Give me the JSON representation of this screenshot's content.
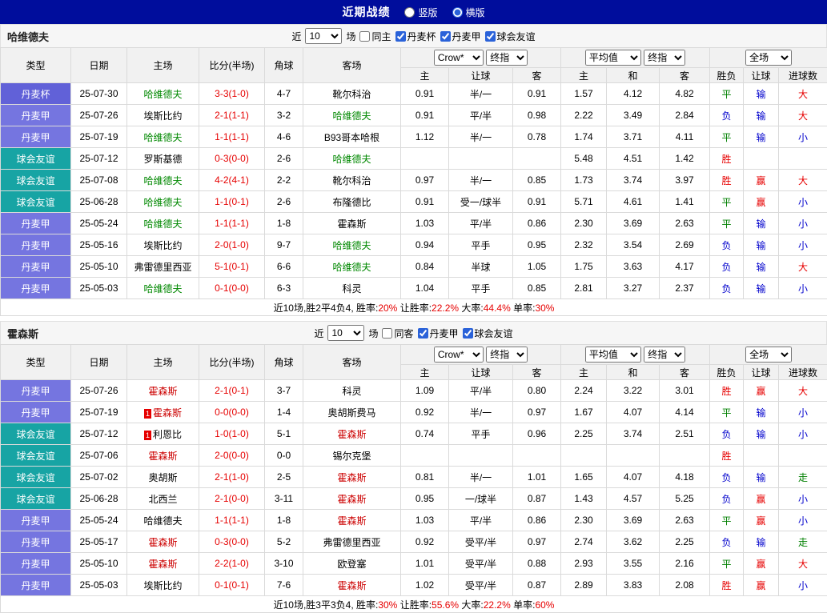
{
  "topbar": {
    "title": "近期战绩",
    "vertical_label": "竖版",
    "horizontal_label": "横版",
    "selected": "横版"
  },
  "colors": {
    "topbar_bg": "#000d9c",
    "league": {
      "丹麦杯": "#6161d8",
      "丹麦甲": "#7575e0",
      "球会友谊": "#17a4a4"
    },
    "result": {
      "胜": "#e60000",
      "平": "#008000",
      "负": "#0000cc",
      "赢": "#e60000",
      "输": "#0000cc",
      "走": "#008000",
      "大": "#e60000",
      "小": "#0000cc"
    },
    "score": "#e60000"
  },
  "selects": {
    "source": "Crow*",
    "time": "终指",
    "avg": "平均值",
    "scope": "全场"
  },
  "columns": [
    "类型",
    "日期",
    "主场",
    "比分(半场)",
    "角球",
    "客场",
    "主",
    "让球",
    "客",
    "主",
    "和",
    "客",
    "胜负",
    "让球",
    "进球数"
  ],
  "sections": [
    {
      "team": "哈维德夫",
      "team_color": "#008800",
      "filters": {
        "pre": "近",
        "count": "10",
        "post": "场",
        "same": "同主",
        "same_checked": false,
        "leagues": [
          {
            "label": "丹麦杯",
            "checked": true
          },
          {
            "label": "丹麦甲",
            "checked": true
          },
          {
            "label": "球会友谊",
            "checked": true
          }
        ]
      },
      "rows": [
        {
          "league": "丹麦杯",
          "date": "25-07-30",
          "home": "哈维德夫",
          "score": "3-3(1-0)",
          "corner": "4-7",
          "away": "靴尔科治",
          "o_home": "0.91",
          "handicap": "半/一",
          "o_away": "0.91",
          "a_home": "1.57",
          "a_draw": "4.12",
          "a_away": "4.82",
          "res": "平",
          "h_res": "输",
          "g_res": "大"
        },
        {
          "league": "丹麦甲",
          "date": "25-07-26",
          "home": "埃斯比约",
          "score": "2-1(1-1)",
          "corner": "3-2",
          "away": "哈维德夫",
          "o_home": "0.91",
          "handicap": "平/半",
          "o_away": "0.98",
          "a_home": "2.22",
          "a_draw": "3.49",
          "a_away": "2.84",
          "res": "负",
          "h_res": "输",
          "g_res": "大"
        },
        {
          "league": "丹麦甲",
          "date": "25-07-19",
          "home": "哈维德夫",
          "score": "1-1(1-1)",
          "corner": "4-6",
          "away": "B93哥本哈根",
          "o_home": "1.12",
          "handicap": "半/一",
          "o_away": "0.78",
          "a_home": "1.74",
          "a_draw": "3.71",
          "a_away": "4.11",
          "res": "平",
          "h_res": "输",
          "g_res": "小"
        },
        {
          "league": "球会友谊",
          "date": "25-07-12",
          "home": "罗斯基德",
          "score": "0-3(0-0)",
          "corner": "2-6",
          "away": "哈维德夫",
          "o_home": "",
          "handicap": "",
          "o_away": "",
          "a_home": "5.48",
          "a_draw": "4.51",
          "a_away": "1.42",
          "res": "胜",
          "h_res": "",
          "g_res": ""
        },
        {
          "league": "球会友谊",
          "date": "25-07-08",
          "home": "哈维德夫",
          "score": "4-2(4-1)",
          "corner": "2-2",
          "away": "靴尔科治",
          "o_home": "0.97",
          "handicap": "半/一",
          "o_away": "0.85",
          "a_home": "1.73",
          "a_draw": "3.74",
          "a_away": "3.97",
          "res": "胜",
          "h_res": "赢",
          "g_res": "大"
        },
        {
          "league": "球会友谊",
          "date": "25-06-28",
          "home": "哈维德夫",
          "score": "1-1(0-1)",
          "corner": "2-6",
          "away": "布隆德比",
          "o_home": "0.91",
          "handicap": "受一/球半",
          "o_away": "0.91",
          "a_home": "5.71",
          "a_draw": "4.61",
          "a_away": "1.41",
          "res": "平",
          "h_res": "赢",
          "g_res": "小"
        },
        {
          "league": "丹麦甲",
          "date": "25-05-24",
          "home": "哈维德夫",
          "score": "1-1(1-1)",
          "corner": "1-8",
          "away": "霍森斯",
          "o_home": "1.03",
          "handicap": "平/半",
          "o_away": "0.86",
          "a_home": "2.30",
          "a_draw": "3.69",
          "a_away": "2.63",
          "res": "平",
          "h_res": "输",
          "g_res": "小"
        },
        {
          "league": "丹麦甲",
          "date": "25-05-16",
          "home": "埃斯比约",
          "score": "2-0(1-0)",
          "corner": "9-7",
          "away": "哈维德夫",
          "o_home": "0.94",
          "handicap": "平手",
          "o_away": "0.95",
          "a_home": "2.32",
          "a_draw": "3.54",
          "a_away": "2.69",
          "res": "负",
          "h_res": "输",
          "g_res": "小"
        },
        {
          "league": "丹麦甲",
          "date": "25-05-10",
          "home": "弗雷德里西亚",
          "score": "5-1(0-1)",
          "corner": "6-6",
          "away": "哈维德夫",
          "o_home": "0.84",
          "handicap": "半球",
          "o_away": "1.05",
          "a_home": "1.75",
          "a_draw": "3.63",
          "a_away": "4.17",
          "res": "负",
          "h_res": "输",
          "g_res": "大"
        },
        {
          "league": "丹麦甲",
          "date": "25-05-03",
          "home": "哈维德夫",
          "score": "0-1(0-0)",
          "corner": "6-3",
          "away": "科灵",
          "o_home": "1.04",
          "handicap": "平手",
          "o_away": "0.85",
          "a_home": "2.81",
          "a_draw": "3.27",
          "a_away": "2.37",
          "res": "负",
          "h_res": "输",
          "g_res": "小"
        }
      ],
      "summary": [
        {
          "t": "近10场,胜2平4负4, 胜率:",
          "red": false
        },
        {
          "t": "20%",
          "red": true
        },
        {
          "t": " 让胜率:",
          "red": false
        },
        {
          "t": "22.2%",
          "red": true
        },
        {
          "t": " 大率:",
          "red": false
        },
        {
          "t": "44.4%",
          "red": true
        },
        {
          "t": " 单率:",
          "red": false
        },
        {
          "t": "30%",
          "red": true
        }
      ]
    },
    {
      "team": "霍森斯",
      "team_color": "#cc0000",
      "filters": {
        "pre": "近",
        "count": "10",
        "post": "场",
        "same": "同客",
        "same_checked": false,
        "leagues": [
          {
            "label": "丹麦甲",
            "checked": true
          },
          {
            "label": "球会友谊",
            "checked": true
          }
        ]
      },
      "rows": [
        {
          "league": "丹麦甲",
          "date": "25-07-26",
          "home": "霍森斯",
          "score": "2-1(0-1)",
          "corner": "3-7",
          "away": "科灵",
          "o_home": "1.09",
          "handicap": "平/半",
          "o_away": "0.80",
          "a_home": "2.24",
          "a_draw": "3.22",
          "a_away": "3.01",
          "res": "胜",
          "h_res": "赢",
          "g_res": "大"
        },
        {
          "league": "丹麦甲",
          "date": "25-07-19",
          "home": "霍森斯",
          "home_cards": "1",
          "score": "0-0(0-0)",
          "corner": "1-4",
          "away": "奥胡斯费马",
          "o_home": "0.92",
          "handicap": "半/一",
          "o_away": "0.97",
          "a_home": "1.67",
          "a_draw": "4.07",
          "a_away": "4.14",
          "res": "平",
          "h_res": "输",
          "g_res": "小"
        },
        {
          "league": "球会友谊",
          "date": "25-07-12",
          "home": "利恩比",
          "home_cards": "1",
          "score": "1-0(1-0)",
          "corner": "5-1",
          "away": "霍森斯",
          "o_home": "0.74",
          "handicap": "平手",
          "o_away": "0.96",
          "a_home": "2.25",
          "a_draw": "3.74",
          "a_away": "2.51",
          "res": "负",
          "h_res": "输",
          "g_res": "小"
        },
        {
          "league": "球会友谊",
          "date": "25-07-06",
          "home": "霍森斯",
          "score": "2-0(0-0)",
          "corner": "0-0",
          "away": "锡尔克堡",
          "o_home": "",
          "handicap": "",
          "o_away": "",
          "a_home": "",
          "a_draw": "",
          "a_away": "",
          "res": "胜",
          "h_res": "",
          "g_res": ""
        },
        {
          "league": "球会友谊",
          "date": "25-07-02",
          "home": "奥胡斯",
          "score": "2-1(1-0)",
          "corner": "2-5",
          "away": "霍森斯",
          "o_home": "0.81",
          "handicap": "半/一",
          "o_away": "1.01",
          "a_home": "1.65",
          "a_draw": "4.07",
          "a_away": "4.18",
          "res": "负",
          "h_res": "输",
          "g_res": "走"
        },
        {
          "league": "球会友谊",
          "date": "25-06-28",
          "home": "北西兰",
          "score": "2-1(0-0)",
          "corner": "3-11",
          "away": "霍森斯",
          "o_home": "0.95",
          "handicap": "一/球半",
          "o_away": "0.87",
          "a_home": "1.43",
          "a_draw": "4.57",
          "a_away": "5.25",
          "res": "负",
          "h_res": "赢",
          "g_res": "小"
        },
        {
          "league": "丹麦甲",
          "date": "25-05-24",
          "home": "哈维德夫",
          "score": "1-1(1-1)",
          "corner": "1-8",
          "away": "霍森斯",
          "o_home": "1.03",
          "handicap": "平/半",
          "o_away": "0.86",
          "a_home": "2.30",
          "a_draw": "3.69",
          "a_away": "2.63",
          "res": "平",
          "h_res": "赢",
          "g_res": "小"
        },
        {
          "league": "丹麦甲",
          "date": "25-05-17",
          "home": "霍森斯",
          "score": "0-3(0-0)",
          "corner": "5-2",
          "away": "弗雷德里西亚",
          "o_home": "0.92",
          "handicap": "受平/半",
          "o_away": "0.97",
          "a_home": "2.74",
          "a_draw": "3.62",
          "a_away": "2.25",
          "res": "负",
          "h_res": "输",
          "g_res": "走"
        },
        {
          "league": "丹麦甲",
          "date": "25-05-10",
          "home": "霍森斯",
          "score": "2-2(1-0)",
          "corner": "3-10",
          "away": "欧登塞",
          "o_home": "1.01",
          "handicap": "受平/半",
          "o_away": "0.88",
          "a_home": "2.93",
          "a_draw": "3.55",
          "a_away": "2.16",
          "res": "平",
          "h_res": "赢",
          "g_res": "大"
        },
        {
          "league": "丹麦甲",
          "date": "25-05-03",
          "home": "埃斯比约",
          "score": "0-1(0-1)",
          "corner": "7-6",
          "away": "霍森斯",
          "o_home": "1.02",
          "handicap": "受平/半",
          "o_away": "0.87",
          "a_home": "2.89",
          "a_draw": "3.83",
          "a_away": "2.08",
          "res": "胜",
          "h_res": "赢",
          "g_res": "小"
        }
      ],
      "summary": [
        {
          "t": "近10场,胜3平3负4, 胜率:",
          "red": false
        },
        {
          "t": "30%",
          "red": true
        },
        {
          "t": " 让胜率:",
          "red": false
        },
        {
          "t": "55.6%",
          "red": true
        },
        {
          "t": " 大率:",
          "red": false
        },
        {
          "t": "22.2%",
          "red": true
        },
        {
          "t": " 单率:",
          "red": false
        },
        {
          "t": "60%",
          "red": true
        }
      ]
    }
  ]
}
